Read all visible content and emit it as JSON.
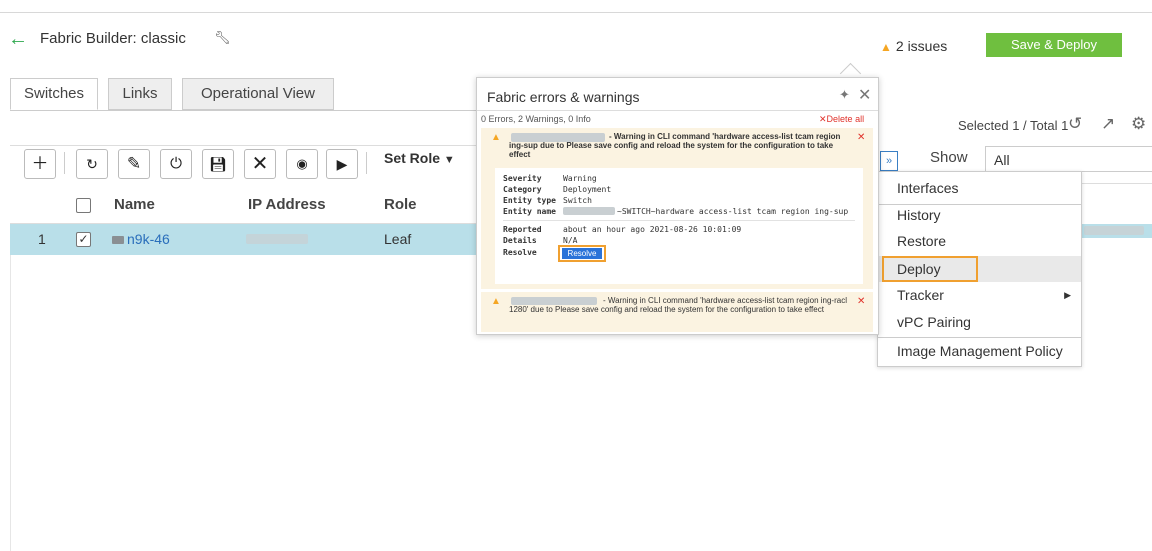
{
  "header": {
    "back_icon": "back-arrow-icon",
    "title_prefix": "Fabric Builder: ",
    "title_name": "classic",
    "issues_text": "2 issues",
    "save_deploy_label": "Save & Deploy"
  },
  "tabs": [
    {
      "label": "Switches"
    },
    {
      "label": "Links"
    },
    {
      "label": "Operational View"
    }
  ],
  "toolbar": {
    "set_role_label": "Set Role"
  },
  "table": {
    "headers": {
      "name": "Name",
      "ip": "IP Address",
      "role": "Role"
    },
    "rows": [
      {
        "index": "1",
        "name": "n9k-46",
        "role": "Leaf"
      }
    ]
  },
  "right_panel": {
    "selected_text": "Selected 1 / Total 1",
    "show_label": "Show",
    "show_value": "All"
  },
  "context_menu": {
    "items": [
      {
        "label": "Interfaces"
      },
      {
        "label": "History"
      },
      {
        "label": "Restore"
      },
      {
        "label": "Deploy"
      },
      {
        "label": "Tracker"
      },
      {
        "label": "vPC Pairing"
      },
      {
        "label": "Image Management Policy"
      }
    ]
  },
  "popup": {
    "title": "Fabric errors & warnings",
    "summary": "0 Errors, 2 Warnings, 0 Info",
    "delete_all": "Delete all",
    "warning1": {
      "message": "- Warning in CLI command 'hardware access-list tcam region ing-sup      due to Please save config and reload the system for the configuration to take effect",
      "labels": {
        "severity": "Severity",
        "category": "Category",
        "entity_type": "Entity type",
        "entity_name": "Entity name",
        "reported": "Reported",
        "details": "Details",
        "resolve": "Resolve"
      },
      "values": {
        "severity": "Warning",
        "category": "Deployment",
        "entity_type": "Switch",
        "entity_name": "~SWITCH~hardware access-list tcam region ing-sup",
        "reported": "about an hour ago 2021-08-26 10:01:09",
        "details": "N/A"
      },
      "resolve_button": "Resolve"
    },
    "warning2": {
      "message": "- Warning in CLI command 'hardware access-list tcam region ing-racl 1280' due to Please save config and reload the system for the configuration to take effect"
    }
  },
  "colors": {
    "accent_green": "#6fbf3f",
    "warning_orange": "#f5a623",
    "highlight_orange": "#f0a030",
    "selected_row": "#b9dfe9",
    "error_red": "#e0322b"
  }
}
